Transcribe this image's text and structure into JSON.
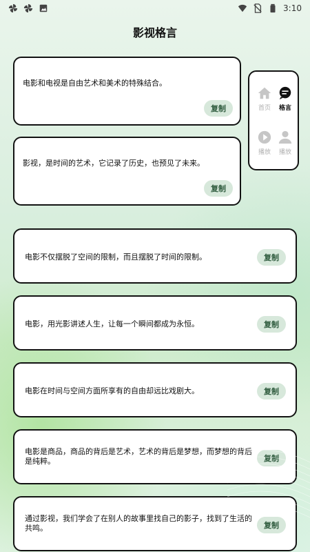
{
  "status_bar": {
    "time": "3:10",
    "left_icons": [
      "pinwheel-icon",
      "pinwheel-icon",
      "image-icon"
    ],
    "right_icons": [
      "wifi-icon",
      "no-sim-icon",
      "battery-icon"
    ]
  },
  "page": {
    "title": "影视格言"
  },
  "nav": {
    "items": [
      {
        "label": "首页",
        "icon": "home-icon",
        "active": false
      },
      {
        "label": "格言",
        "icon": "chat-icon",
        "active": true
      },
      {
        "label": "播放",
        "icon": "play-icon",
        "active": false
      },
      {
        "label": "播放",
        "icon": "person-icon",
        "active": false
      }
    ]
  },
  "quotes": [
    {
      "text": "电影和电视是自由艺术和美术的特殊结合。",
      "copy_label": "复制"
    },
    {
      "text": "影视，是时间的艺术，它记录了历史，也预见了未来。",
      "copy_label": "复制"
    },
    {
      "text": "电影不仅摆脱了空间的限制，而且摆脱了时间的限制。",
      "copy_label": "复制"
    },
    {
      "text": "电影，用光影讲述人生，让每一个瞬间都成为永恒。",
      "copy_label": "复制"
    },
    {
      "text": "电影在时间与空间方面所享有的自由却远比戏剧大。",
      "copy_label": "复制"
    },
    {
      "text": "电影是商品，商品的背后是艺术，艺术的背后是梦想，而梦想的背后是纯粹。",
      "copy_label": "复制"
    },
    {
      "text": "通过影视，我们学会了在别人的故事里找自己的影子，找到了生活的共鸣。",
      "copy_label": "复制"
    }
  ],
  "colors": {
    "copy_button_bg": "#d7e8db",
    "copy_button_text": "#2f5b3e",
    "active_nav": "#111111",
    "inactive_nav": "#b0b0b0"
  }
}
